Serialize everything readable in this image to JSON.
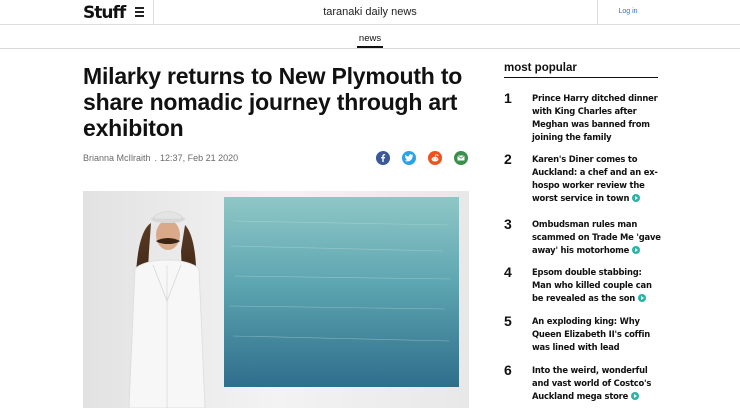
{
  "header": {
    "logo": "Stuff",
    "brand": "taranaki daily news",
    "login": "Log in",
    "section": "news"
  },
  "article": {
    "headline": "Milarky returns to New Plymouth to share nomadic journey through art exhibiton",
    "author": "Brianna McIlraith",
    "timestamp": "12:37, Feb 21 2020",
    "share_icons": [
      "facebook-icon",
      "twitter-icon",
      "reddit-icon",
      "email-icon"
    ],
    "image_alt": "Artist in white suit and hat with long hair and moustache standing beside a large blue painting"
  },
  "most_popular": {
    "title": "most popular",
    "items": [
      {
        "rank": "1",
        "text": "Prince Harry ditched dinner with King Charles after Meghan was banned from joining the family",
        "video": false
      },
      {
        "rank": "2",
        "text": "Karen's Diner comes to Auckland: a chef and an ex-hospo worker review the worst service in town",
        "video": true
      },
      {
        "rank": "3",
        "text": "Ombudsman rules man scammed on Trade Me 'gave away' his motorhome",
        "video": true
      },
      {
        "rank": "4",
        "text": "Epsom double stabbing: Man who killed couple can be revealed as the son",
        "video": true
      },
      {
        "rank": "5",
        "text": "An exploding king: Why Queen Elizabeth II's coffin was lined with lead",
        "video": false
      },
      {
        "rank": "6",
        "text": "Into the weird, wonderful and vast world of Costco's Auckland mega store",
        "video": true
      }
    ]
  },
  "colors": {
    "facebook": "#3b5998",
    "twitter": "#2aa3e6",
    "reddit": "#f0511d",
    "email": "#3a8f4a",
    "video_badge": "#2bb3a6",
    "login_link": "#2f6fd1"
  }
}
